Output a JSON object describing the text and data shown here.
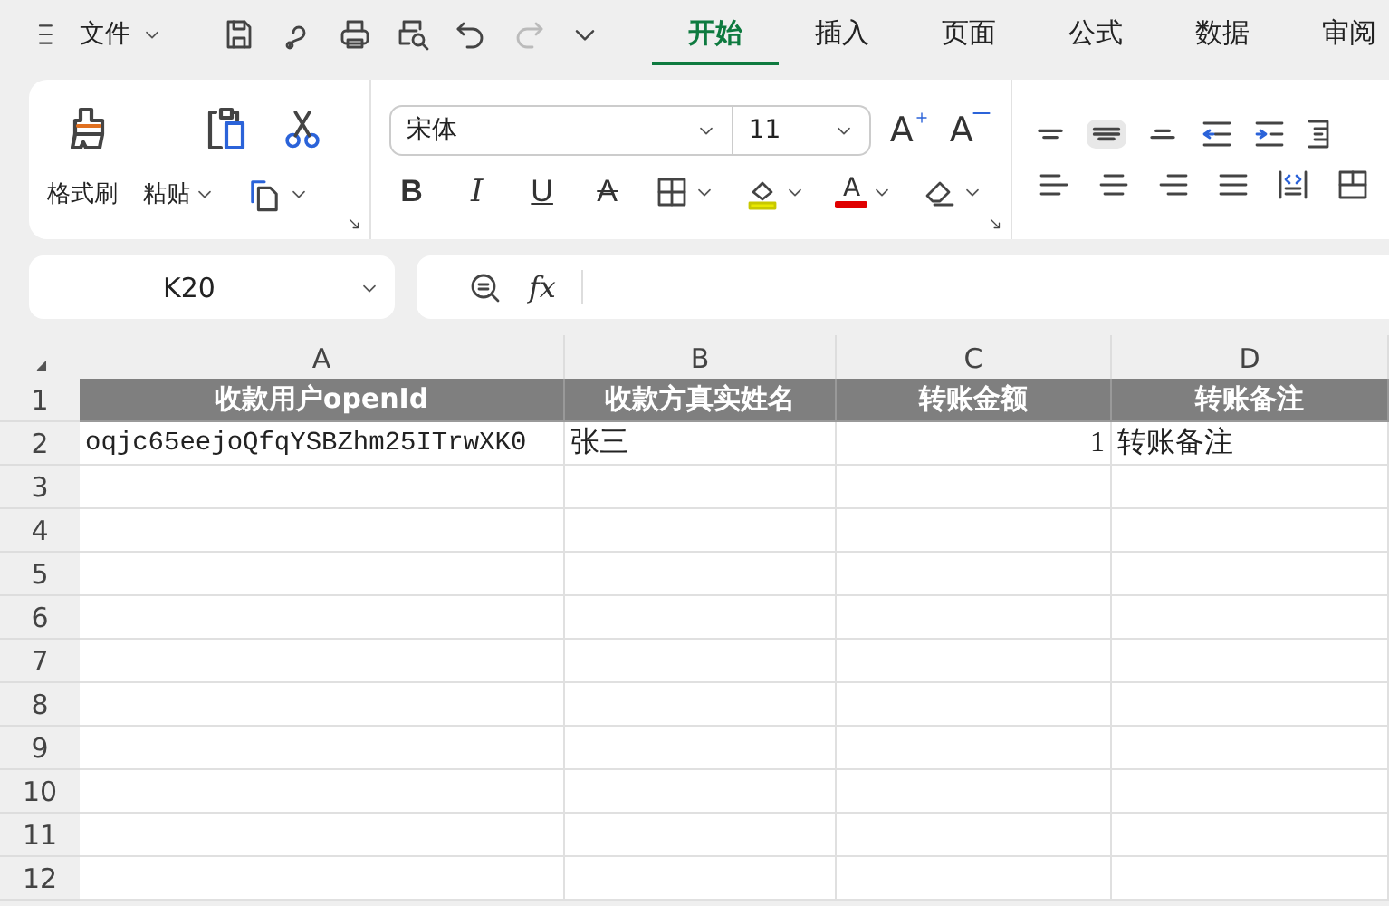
{
  "menu": {
    "label": "文件"
  },
  "tabs": [
    {
      "label": "开始",
      "selected": true
    },
    {
      "label": "插入",
      "selected": false
    },
    {
      "label": "页面",
      "selected": false
    },
    {
      "label": "公式",
      "selected": false
    },
    {
      "label": "数据",
      "selected": false
    },
    {
      "label": "审阅",
      "selected": false
    }
  ],
  "quick_access": {
    "redo_disabled": true
  },
  "ribbon": {
    "format_painter": "格式刷",
    "paste": "粘贴",
    "font_name": "宋体",
    "font_size": "11",
    "size_buttons": [
      {
        "kind": "grow",
        "label": "A"
      },
      {
        "kind": "shrink",
        "label": "A"
      }
    ],
    "text_format": [
      {
        "kind": "bold",
        "label": "B"
      },
      {
        "kind": "italic",
        "label": "I"
      },
      {
        "kind": "underline",
        "label": "U"
      },
      {
        "kind": "strike",
        "label": "A"
      }
    ],
    "font_color_label": "A",
    "vertical_align": [
      {
        "selected": false
      },
      {
        "selected": true
      },
      {
        "selected": false
      }
    ]
  },
  "formula_bar": {
    "name_box": "K20",
    "fx": "fx"
  },
  "sheet": {
    "columns": [
      {
        "label": "A",
        "kind": "text"
      },
      {
        "label": "B",
        "kind": "text"
      },
      {
        "label": "C",
        "kind": "number"
      },
      {
        "label": "D",
        "kind": "text"
      }
    ],
    "rows": [
      {
        "number": "1",
        "kind": "header",
        "cells": [
          "收款用户openId",
          "收款方真实姓名",
          "转账金额",
          "转账备注"
        ]
      },
      {
        "number": "2",
        "kind": "data",
        "cells": [
          "oqjc65eejoQfqYSBZhm25ITrwXK0",
          "张三",
          "1",
          "转账备注"
        ]
      },
      {
        "number": "3"
      },
      {
        "number": "4"
      },
      {
        "number": "5"
      },
      {
        "number": "6"
      },
      {
        "number": "7"
      },
      {
        "number": "8"
      },
      {
        "number": "9"
      },
      {
        "number": "10"
      },
      {
        "number": "11"
      },
      {
        "number": "12"
      }
    ]
  }
}
